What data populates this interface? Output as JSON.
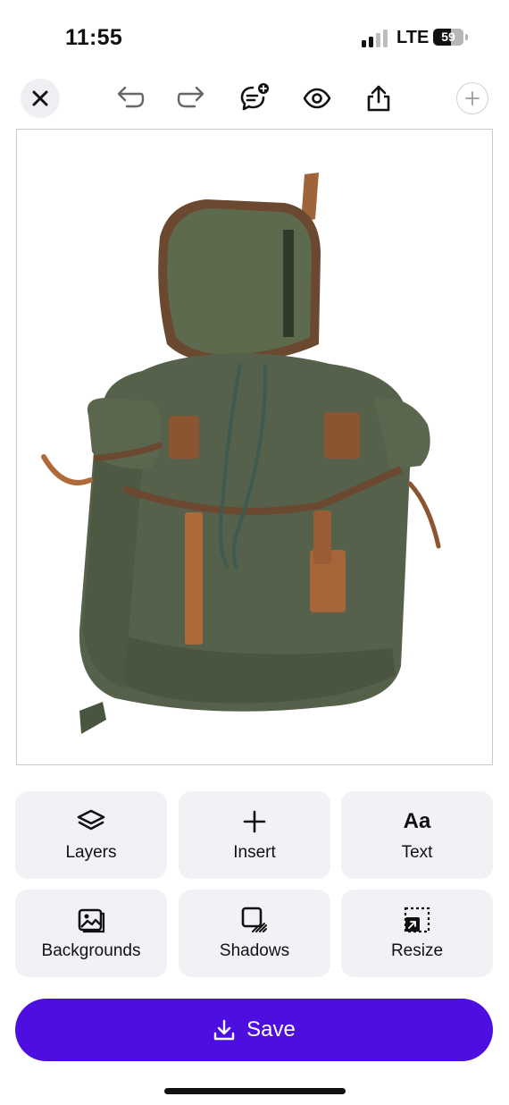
{
  "status_bar": {
    "time": "11:55",
    "network": "LTE",
    "battery_level": "59"
  },
  "toolbar": {
    "icons": [
      "close-icon",
      "undo-icon",
      "redo-icon",
      "comment-add-icon",
      "eye-icon",
      "share-icon",
      "plus-icon"
    ]
  },
  "canvas": {
    "subject": "backpack-photo"
  },
  "tools": [
    {
      "label": "Layers",
      "icon": "layers-icon"
    },
    {
      "label": "Insert",
      "icon": "plus-icon"
    },
    {
      "label": "Text",
      "icon": "text-icon",
      "glyph": "Aa"
    },
    {
      "label": "Backgrounds",
      "icon": "backgrounds-icon"
    },
    {
      "label": "Shadows",
      "icon": "shadows-icon"
    },
    {
      "label": "Resize",
      "icon": "resize-icon"
    }
  ],
  "save": {
    "label": "Save",
    "icon": "download-icon"
  },
  "colors": {
    "accent": "#4c0fe0",
    "tile": "#f1f2f6"
  }
}
